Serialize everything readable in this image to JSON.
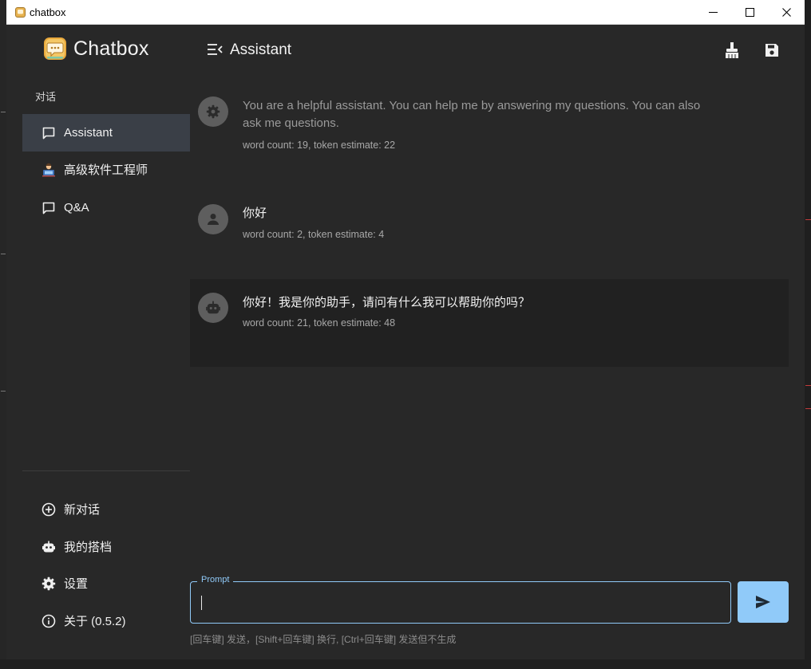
{
  "window": {
    "title": "chatbox"
  },
  "sidebar": {
    "app_name": "Chatbox",
    "section_label": "对话",
    "sessions": [
      {
        "label": "Assistant",
        "icon": "chat-bubble-icon",
        "active": true
      },
      {
        "label": "高级软件工程师",
        "icon": "developer-avatar-icon",
        "active": false
      },
      {
        "label": "Q&A",
        "icon": "chat-bubble-icon",
        "active": false
      }
    ],
    "bottom": [
      {
        "label": "新对话",
        "icon": "add-circle-icon"
      },
      {
        "label": "我的搭档",
        "icon": "robot-icon"
      },
      {
        "label": "设置",
        "icon": "gear-icon"
      },
      {
        "label": "关于 (0.5.2)",
        "icon": "info-icon"
      }
    ]
  },
  "header": {
    "title": "Assistant"
  },
  "messages": [
    {
      "role": "system",
      "avatar": "gear-icon",
      "text": "You are a helpful assistant. You can help me by answering my questions. You can also ask me questions.",
      "meta": "word count: 19, token estimate: 22"
    },
    {
      "role": "user",
      "avatar": "person-icon",
      "text": "你好",
      "meta": "word count: 2, token estimate: 4"
    },
    {
      "role": "assistant",
      "avatar": "robot-icon",
      "text": "你好！我是你的助手，请问有什么我可以帮助你的吗？",
      "meta": "word count: 21, token estimate: 48"
    }
  ],
  "input": {
    "label": "Prompt",
    "value": "",
    "hint": "[回车键] 发送，[Shift+回车键] 换行, [Ctrl+回车键] 发送但不生成"
  },
  "colors": {
    "accent": "#90caf9",
    "active_item": "#3a3f47",
    "background": "#282828",
    "assistant_bg": "#212121"
  }
}
